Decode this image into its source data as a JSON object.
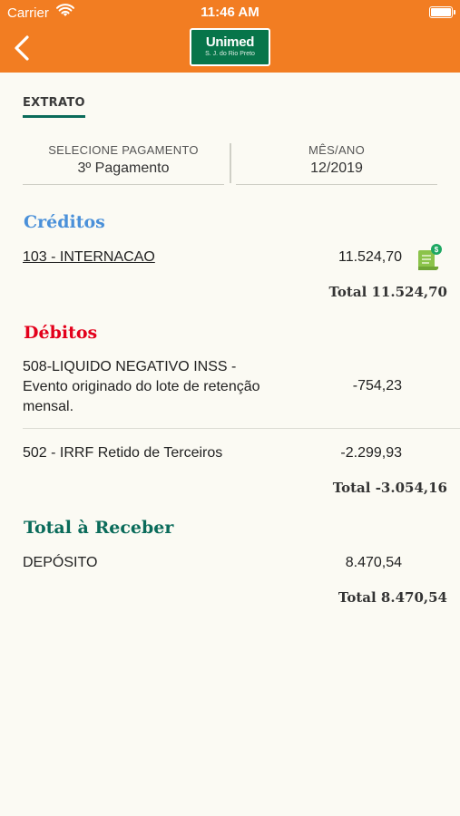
{
  "status_bar": {
    "carrier": "Carrier",
    "time": "11:46 AM"
  },
  "header": {
    "logo_main": "Unimed",
    "logo_sub": "S. J. do Rio Preto",
    "icons": {
      "back": "chevron-left-icon",
      "signal": "wifi-icon",
      "power": "battery-icon"
    }
  },
  "tab": {
    "label": "EXTRATO"
  },
  "selectors": {
    "payment": {
      "label": "SELECIONE PAGAMENTO",
      "value": "3º Pagamento"
    },
    "period": {
      "label": "MÊS/ANO",
      "value": "12/2019"
    }
  },
  "credits": {
    "title": "Créditos",
    "items": [
      {
        "label": "103 - INTERNACAO",
        "value": "11.524,70"
      }
    ],
    "total": "Total 11.524,70"
  },
  "debits": {
    "title": "Débitos",
    "items": [
      {
        "label_lines": [
          "508-LIQUIDO NEGATIVO INSS -",
          "Evento originado do lote de retenção",
          "mensal."
        ],
        "value": "-754,23"
      },
      {
        "label": "502 - IRRF Retido de Terceiros",
        "value": "-2.299,93"
      }
    ],
    "total": "Total -3.054,16"
  },
  "receivable": {
    "title": "Total à Receber",
    "items": [
      {
        "label": "DEPÓSITO",
        "value": "8.470,54"
      }
    ],
    "total": "Total 8.470,54"
  },
  "colors": {
    "header_bg": "#f27d22",
    "credits_title": "#4a90d9",
    "debits_title": "#e3001b",
    "receivable_title": "#0a6b5a",
    "logo_bg": "#07754a",
    "receipt_icon": "#8bc34a"
  }
}
